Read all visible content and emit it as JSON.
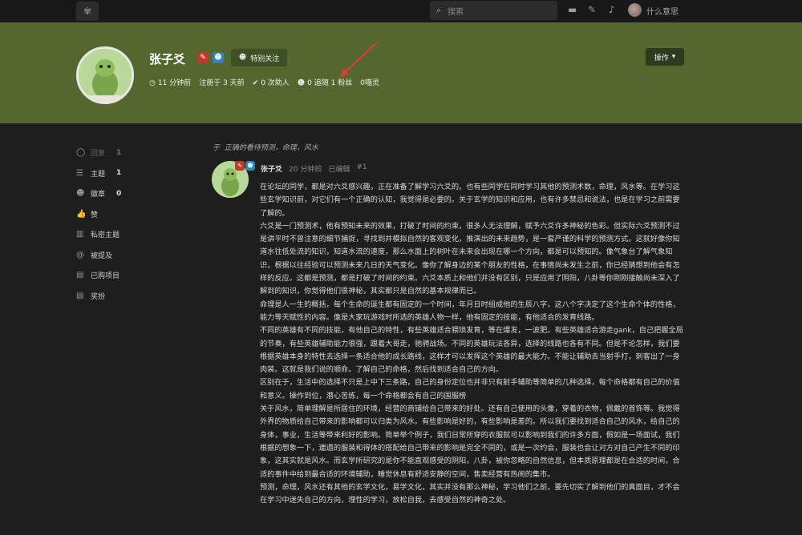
{
  "topbar": {
    "logo_icon": "gear-flower-icon",
    "search_placeholder": "搜索",
    "icons": [
      "chat-icon",
      "edit-icon",
      "bell-icon"
    ],
    "user_name": "什么意思"
  },
  "profile": {
    "name": "张子爻",
    "follow_label": "特别关注",
    "ops_label": "操作",
    "stats": [
      {
        "icon": "clock-icon",
        "text": "11 分钟前"
      },
      {
        "icon": "",
        "text": "注册于 3 天前"
      },
      {
        "icon": "check-icon",
        "text": "0 次助人"
      },
      {
        "icon": "users-icon",
        "text": "0 追随 1 粉丝"
      },
      {
        "icon": "",
        "text": "0喵灵"
      }
    ],
    "accent": "#53672f"
  },
  "sidebar": {
    "items": [
      {
        "icon": "reply-icon",
        "label": "回复",
        "count": "1",
        "dim": true
      },
      {
        "icon": "list-icon",
        "label": "主题",
        "count": "1",
        "dim": false
      },
      {
        "icon": "user-group-icon",
        "label": "徽章",
        "count": "0",
        "dim": false
      },
      {
        "icon": "thumbs-up-icon",
        "label": "赞",
        "count": "",
        "dim": false
      },
      {
        "icon": "map-icon",
        "label": "私密主题",
        "count": "",
        "dim": false
      },
      {
        "icon": "at-icon",
        "label": "被提及",
        "count": "",
        "dim": false
      },
      {
        "icon": "file-icon",
        "label": "已购项目",
        "count": "",
        "dim": false
      },
      {
        "icon": "file-icon",
        "label": "奖扮",
        "count": "",
        "dim": false
      }
    ]
  },
  "thread": {
    "prefix": "于",
    "title": "正确的看待预测，命理，风水"
  },
  "post": {
    "author": "张子爻",
    "time": "20 分钟前",
    "edited": "已编辑",
    "number": "#1",
    "paragraphs": [
      "在论坛的同学，都是对六爻感兴趣，正在准备了解学习六爻的。也有些同学在同时学习其他的预测术数，命理，风水等。在学习这些玄学知识前，对它们有一个正确的认知，我觉得是必要的。关于玄学的知识和应用，也有许多禁忌和说法，也是在学习之前需要了解的。",
      "六爻是一门预测术，他有预知未来的效果，打破了时间的约束，很多人无法理解，赋予六爻许多神秘的色彩。但实际六爻预测不过是讲平时不曾注意的细节捕捉，寻找到并模拟自然的客观变化，推演出的未来趋势，是一套严谨的科学的预测方式。这就好像你知道水往低处流的知识，知道水流的速度，那么水面上的树叶在未来会出现在哪一个方向，都是可以预知的。像气象台了解气象知识，根据以往经验可以预测未来几日的天气变化。像你了解身边的某个朋友的性格，在事情尚未发生之前，你已经猜想到他会有怎样的反应。这都是预测，都是打破了时间的约束。六爻本质上和他们并没有区别，只是应用了阴阳，八卦等你刚刚接触尚未深入了解到的知识，你觉得他们很神秘，其实都只是自然的基本规律而已。",
      "命理是人一生的概括，每个生命的诞生都有固定的一个时间，年月日时组成他的生辰八字，这八个字决定了这个生命个体的性格，能力等天赋性的内容。像是大家玩游戏时所选的英雄人物一样，他有固定的技能，有他适合的发育线路。",
      "不同的英雄有不同的技能，有他自己的特性，有些英雄适合猥琐发育，等在爆发，一波肥。有些英雄适合游走gank，自己把握全局的节奏，有些英雄辅助能力很强，跟着大哥走，驰骋战场。不同的英雄玩法各异，选择的线路也各有不同。但是不论怎样，我们要根据英雄本身的特性去选择一条适合他的成长路线，这样才可以发挥这个英雄的最大能力。不能让辅助去当射手打，刺客出了一身肉装。这就是我们说的顺命。了解自己的命格，然后找到适合自己的方向。",
      "区别在于，生活中的选择不只是上中下三条路，自己的身份定位也并非只有射手辅助等简单的几种选择，每个命格都有自己的价值和意义。操作到位，潜心苦练，每一个命格都会有自己的国服榜",
      "关于风水，简单理解是所居住的环境，经营的商铺给自己带来的好处。还有自己使用的头像，穿着的衣物，佩戴的首饰等。我觉得外界的物质给自己带来的影响都可以归类为风水。有些影响是好的，有些影响是差的。所以我们要找到适合自己的风水，给自己的身体，事业，生活等带来利好的影响。简单举个例子，我们日常所穿的衣服就可以影响到我们的许多方面，假如是一场面试，我们根据的想象一下，邋遢的服装和得体的搭配给自己带来的影响是完全不同的，或是一次约会，服装也会让对方对自己产生不同的印象，这其实就是风水。而玄学所研究的是你不能直观感受的阴阳，八卦，被你忽略的自然信息，但本质原理都是在合适的时间，合适的事件中给到最合适的环境辅助，睡觉休息有舒适安静的空间，售卖经营有热闹的集市。",
      "预测，命理，风水还有其他的玄学文化，易学文化，其实并没有那么神秘，学习他们之前，要先切实了解到他们的真面目，才不会在学习中迷失自己的方向，理性的学习，放松自我，去感受自然的神奇之处。"
    ]
  }
}
